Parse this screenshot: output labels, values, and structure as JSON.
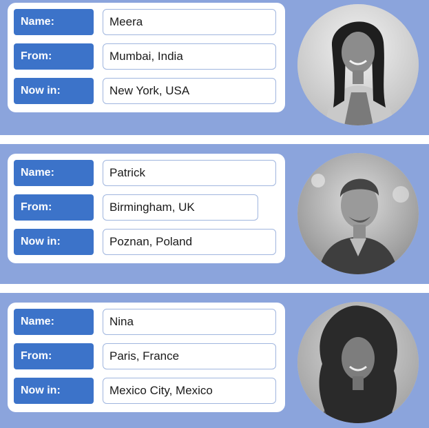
{
  "profiles": [
    {
      "fields": [
        {
          "label": "Name:",
          "value": "Meera"
        },
        {
          "label": "From:",
          "value": "Mumbai, India"
        },
        {
          "label": "Now in:",
          "value": "New York, USA"
        }
      ]
    },
    {
      "fields": [
        {
          "label": "Name:",
          "value": "Patrick"
        },
        {
          "label": "From:",
          "value": "Birmingham, UK"
        },
        {
          "label": "Now in:",
          "value": "Poznan, Poland"
        }
      ]
    },
    {
      "fields": [
        {
          "label": "Name:",
          "value": "Nina"
        },
        {
          "label": "From:",
          "value": "Paris, France"
        },
        {
          "label": "Now in:",
          "value": "Mexico City, Mexico"
        }
      ]
    }
  ],
  "colors": {
    "band": "#8ba4dc",
    "label_bg": "#3c73c9",
    "field_border": "#9fb5de"
  }
}
